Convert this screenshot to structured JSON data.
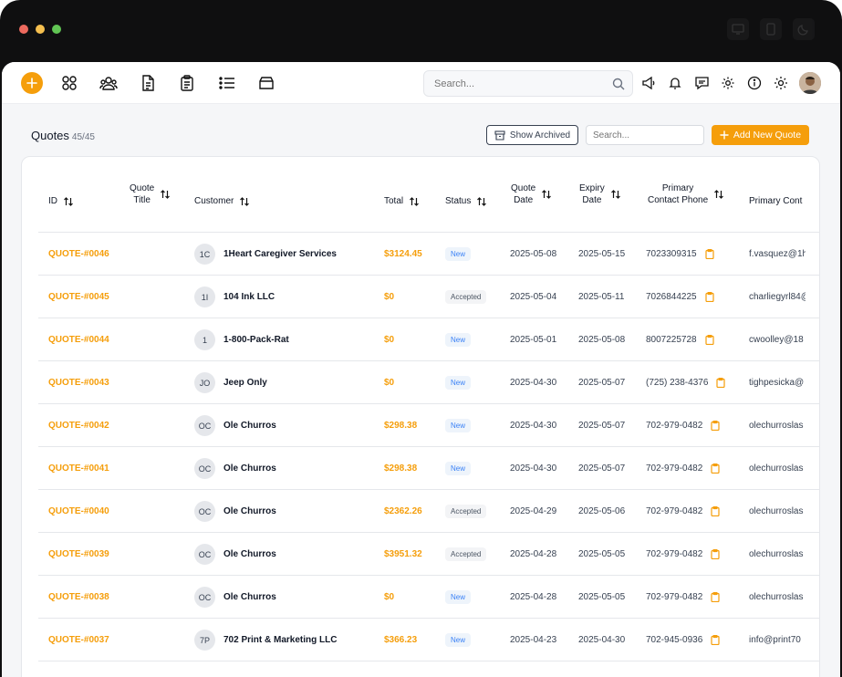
{
  "colors": {
    "accent": "#f59e0b",
    "new_badge": "#3b82f6",
    "dot_red": "#ed6a5e",
    "dot_yellow": "#f5bf4f",
    "dot_green": "#61c554"
  },
  "topbar": {
    "add_icon": "plus-circle-icon",
    "nav_icons": [
      "dashboard-grid-icon",
      "customers-icon",
      "document-icon",
      "clipboard-icon",
      "list-icon",
      "archive-box-icon"
    ],
    "search_placeholder": "Search...",
    "right_icons": [
      "megaphone-icon",
      "bell-icon",
      "chat-icon",
      "gear-icon",
      "info-icon",
      "sun-icon"
    ]
  },
  "page": {
    "title": "Quotes",
    "count": "45/45",
    "show_archived": "Show Archived",
    "search_placeholder": "Search...",
    "add_new": "Add New Quote"
  },
  "table": {
    "columns": {
      "id": "ID",
      "quote_title": "Quote\nTitle",
      "customer": "Customer",
      "total": "Total",
      "status": "Status",
      "quote_date": "Quote\nDate",
      "expiry_date": "Expiry\nDate",
      "primary_phone": "Primary\nContact Phone",
      "primary_email": "Primary Cont"
    },
    "rows": [
      {
        "id": "QUOTE-#0046",
        "initials": "1C",
        "customer": "1Heart Caregiver Services",
        "total": "$3124.45",
        "status": "New",
        "quote_date": "2025-05-08",
        "expiry_date": "2025-05-15",
        "phone": "7023309315",
        "email": "f.vasquez@1h"
      },
      {
        "id": "QUOTE-#0045",
        "initials": "1I",
        "customer": "104 Ink LLC",
        "total": "$0",
        "status": "Accepted",
        "quote_date": "2025-05-04",
        "expiry_date": "2025-05-11",
        "phone": "7026844225",
        "email": "charliegyrl84@"
      },
      {
        "id": "QUOTE-#0044",
        "initials": "1",
        "customer": "1-800-Pack-Rat",
        "total": "$0",
        "status": "New",
        "quote_date": "2025-05-01",
        "expiry_date": "2025-05-08",
        "phone": "8007225728",
        "email": "cwoolley@18"
      },
      {
        "id": "QUOTE-#0043",
        "initials": "JO",
        "customer": "Jeep Only",
        "total": "$0",
        "status": "New",
        "quote_date": "2025-04-30",
        "expiry_date": "2025-05-07",
        "phone": "(725) 238-4376",
        "email": "tighpesicka@"
      },
      {
        "id": "QUOTE-#0042",
        "initials": "OC",
        "customer": "Ole Churros",
        "total": "$298.38",
        "status": "New",
        "quote_date": "2025-04-30",
        "expiry_date": "2025-05-07",
        "phone": "702-979-0482",
        "email": "olechurroslas"
      },
      {
        "id": "QUOTE-#0041",
        "initials": "OC",
        "customer": "Ole Churros",
        "total": "$298.38",
        "status": "New",
        "quote_date": "2025-04-30",
        "expiry_date": "2025-05-07",
        "phone": "702-979-0482",
        "email": "olechurroslas"
      },
      {
        "id": "QUOTE-#0040",
        "initials": "OC",
        "customer": "Ole Churros",
        "total": "$2362.26",
        "status": "Accepted",
        "quote_date": "2025-04-29",
        "expiry_date": "2025-05-06",
        "phone": "702-979-0482",
        "email": "olechurroslas"
      },
      {
        "id": "QUOTE-#0039",
        "initials": "OC",
        "customer": "Ole Churros",
        "total": "$3951.32",
        "status": "Accepted",
        "quote_date": "2025-04-28",
        "expiry_date": "2025-05-05",
        "phone": "702-979-0482",
        "email": "olechurroslas"
      },
      {
        "id": "QUOTE-#0038",
        "initials": "OC",
        "customer": "Ole Churros",
        "total": "$0",
        "status": "New",
        "quote_date": "2025-04-28",
        "expiry_date": "2025-05-05",
        "phone": "702-979-0482",
        "email": "olechurroslas"
      },
      {
        "id": "QUOTE-#0037",
        "initials": "7P",
        "customer": "702 Print & Marketing LLC",
        "total": "$366.23",
        "status": "New",
        "quote_date": "2025-04-23",
        "expiry_date": "2025-04-30",
        "phone": "702-945-0936",
        "email": "info@print70"
      }
    ]
  }
}
